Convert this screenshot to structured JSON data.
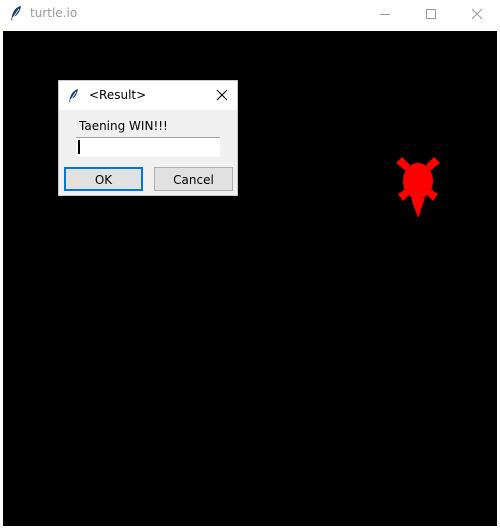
{
  "window": {
    "title": "turtle.io",
    "icon": "feather-icon",
    "controls": [
      "minimize-icon",
      "maximize-icon",
      "close-icon"
    ]
  },
  "canvas": {
    "background": "#000000",
    "turtle_color": "#ff0000",
    "turtle_icon": "turtle-icon"
  },
  "dialog": {
    "title": "<Result>",
    "icon": "feather-icon",
    "message": "Taening WIN!!!",
    "input_value": "",
    "ok_label": "OK",
    "cancel_label": "Cancel",
    "accent": "#0078d7"
  }
}
